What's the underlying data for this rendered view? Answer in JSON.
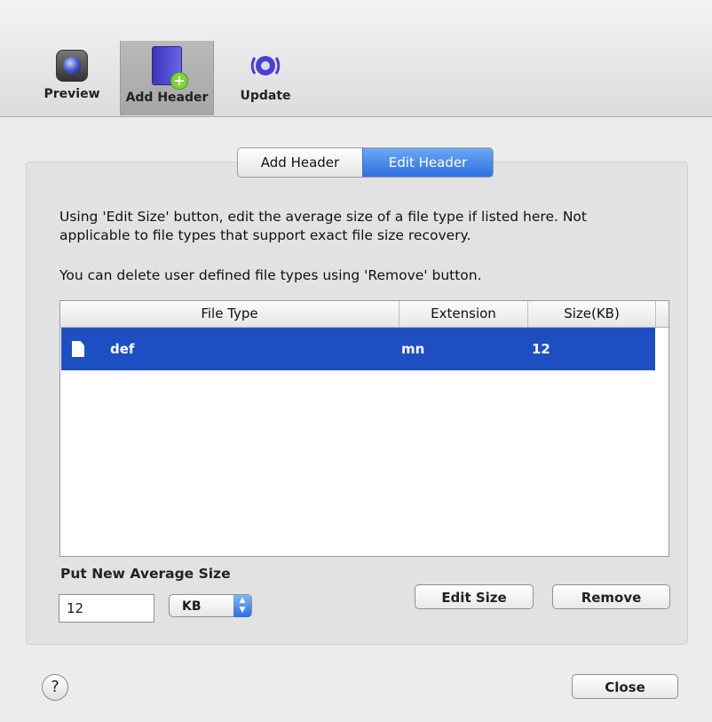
{
  "toolbar": {
    "items": [
      {
        "label": "Preview",
        "icon": "preview-icon"
      },
      {
        "label": "Add Header",
        "icon": "add-header-icon",
        "selected": true
      },
      {
        "label": "Update",
        "icon": "update-icon"
      }
    ]
  },
  "tabs": [
    {
      "label": "Add Header",
      "active": false
    },
    {
      "label": "Edit Header",
      "active": true
    }
  ],
  "info": {
    "line1": "Using 'Edit Size' button, edit the average size of a file type if listed here. Not",
    "line2": "applicable to file types that support exact file size recovery.",
    "line3": "You can delete user defined file types using 'Remove' button."
  },
  "table": {
    "columns": [
      "File Type",
      "Extension",
      "Size(KB)"
    ],
    "rows": [
      {
        "file_type": "def",
        "extension": "mn",
        "size": "12",
        "selected": true
      }
    ]
  },
  "average": {
    "label": "Put New Average Size",
    "value": "12",
    "unit": "KB"
  },
  "buttons": {
    "edit_size": "Edit Size",
    "remove": "Remove",
    "close": "Close",
    "help": "?"
  },
  "colors": {
    "selection": "#1e4fc2",
    "active_tab": "#2d6fe0"
  }
}
